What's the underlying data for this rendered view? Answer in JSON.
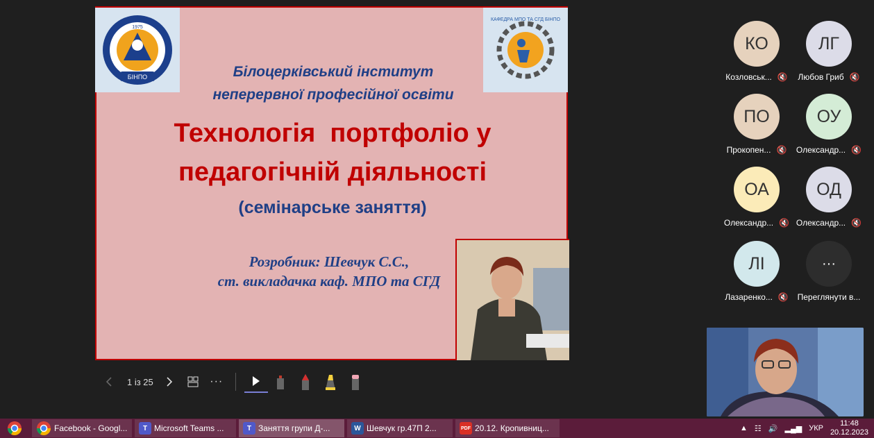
{
  "slide": {
    "institute_line1": "Білоцерківський інститут",
    "institute_line2": "неперервної професійної освіти",
    "title_line1": "Технологія  портфоліо у",
    "title_line2": "педагогічній діяльності",
    "subtitle": "(семінарське заняття)",
    "author_line1": "Розробник: Шевчук С.С.,",
    "author_line2": "ст. викладачка каф. МПО та СГД",
    "logo_left_text": "БІНПО",
    "logo_left_year": "1975",
    "logo_right_text": "КАФЕДРА МПО ТА СГД БІНПО"
  },
  "controls": {
    "page_indicator": "1 із 25",
    "prev_icon": "chevron-left-icon",
    "next_icon": "chevron-right-icon",
    "grid_icon": "slides-grid-icon",
    "more_icon": "more-icon",
    "tools": [
      "pointer-icon",
      "eraser-icon",
      "pen-red-icon",
      "highlighter-icon",
      "pen-pink-icon"
    ]
  },
  "participants": [
    {
      "initials": "КО",
      "name": "Козловськ...",
      "color": "#e6d2bd"
    },
    {
      "initials": "ЛГ",
      "name": "Любов Гриб",
      "color": "#dcdce8"
    },
    {
      "initials": "ПО",
      "name": "Прокопен...",
      "color": "#e6d2bd"
    },
    {
      "initials": "ОУ",
      "name": "Олександр...",
      "color": "#d4ecd6"
    },
    {
      "initials": "ОА",
      "name": "Олександр...",
      "color": "#fbebb8"
    },
    {
      "initials": "ОД",
      "name": "Олександр...",
      "color": "#dcdce8"
    },
    {
      "initials": "ЛІ",
      "name": "Лазаренко...",
      "color": "#d2e8ec"
    }
  ],
  "more_participants": {
    "label": "Переглянути в...",
    "icon": "ellipsis"
  },
  "taskbar": {
    "items": [
      {
        "label": "Facebook - Googl...",
        "icon": "chrome"
      },
      {
        "label": "Microsoft Teams ...",
        "icon": "T"
      },
      {
        "label": "Заняття групи Д-...",
        "icon": "T"
      },
      {
        "label": "Шевчук гр.47П 2...",
        "icon": "W"
      },
      {
        "label": "20.12. Кропивниц...",
        "icon": "PDF"
      }
    ],
    "language": "УКР",
    "time": "11:48",
    "date": "20.12.2023"
  }
}
